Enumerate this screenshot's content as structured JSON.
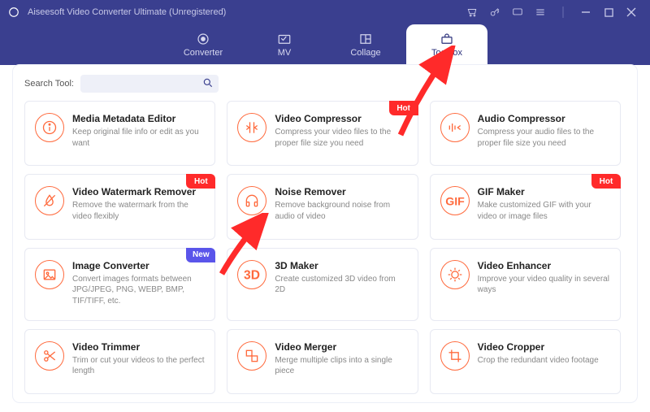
{
  "window": {
    "title": "Aiseesoft Video Converter Ultimate (Unregistered)"
  },
  "tabs": {
    "converter": "Converter",
    "mv": "MV",
    "collage": "Collage",
    "toolbox": "Toolbox"
  },
  "search": {
    "label": "Search Tool:",
    "placeholder": ""
  },
  "badges": {
    "hot": "Hot",
    "new": "New"
  },
  "tools": [
    {
      "id": "media-metadata-editor",
      "title": "Media Metadata Editor",
      "desc": "Keep original file info or edit as you want",
      "icon": "info",
      "badge": null
    },
    {
      "id": "video-compressor",
      "title": "Video Compressor",
      "desc": "Compress your video files to the proper file size you need",
      "icon": "compress",
      "badge": "hot"
    },
    {
      "id": "audio-compressor",
      "title": "Audio Compressor",
      "desc": "Compress your audio files to the proper file size you need",
      "icon": "audio-compress",
      "badge": null
    },
    {
      "id": "video-watermark-remover",
      "title": "Video Watermark Remover",
      "desc": "Remove the watermark from the video flexibly",
      "icon": "no-water",
      "badge": "hot"
    },
    {
      "id": "noise-remover",
      "title": "Noise Remover",
      "desc": "Remove background noise from audio of video",
      "icon": "headphones",
      "badge": null
    },
    {
      "id": "gif-maker",
      "title": "GIF Maker",
      "desc": "Make customized GIF with your video or image files",
      "icon": "gif",
      "badge": "hot"
    },
    {
      "id": "image-converter",
      "title": "Image Converter",
      "desc": "Convert images formats between JPG/JPEG, PNG, WEBP, BMP, TIF/TIFF, etc.",
      "icon": "image",
      "badge": "new"
    },
    {
      "id": "3d-maker",
      "title": "3D Maker",
      "desc": "Create customized 3D video from 2D",
      "icon": "3d",
      "badge": null
    },
    {
      "id": "video-enhancer",
      "title": "Video Enhancer",
      "desc": "Improve your video quality in several ways",
      "icon": "enhance",
      "badge": null
    },
    {
      "id": "video-trimmer",
      "title": "Video Trimmer",
      "desc": "Trim or cut your videos to the perfect length",
      "icon": "scissors",
      "badge": null
    },
    {
      "id": "video-merger",
      "title": "Video Merger",
      "desc": "Merge multiple clips into a single piece",
      "icon": "merge",
      "badge": null
    },
    {
      "id": "video-cropper",
      "title": "Video Cropper",
      "desc": "Crop the redundant video footage",
      "icon": "crop",
      "badge": null
    }
  ]
}
